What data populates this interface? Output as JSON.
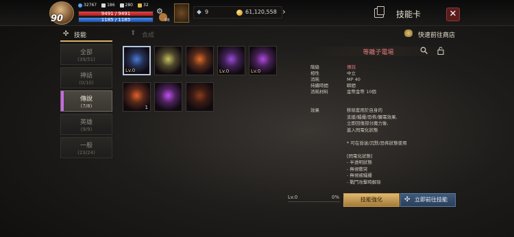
{
  "player": {
    "level": "90",
    "stats": [
      {
        "icon": "blue-gem-icon",
        "value": "32767",
        "color": "#5aa0ff"
      },
      {
        "icon": "sword-icon",
        "value": "186",
        "color": "#d8d8d8"
      },
      {
        "icon": "skull-icon",
        "value": "280",
        "color": "#d8d8d8"
      },
      {
        "icon": "trophy-icon",
        "value": "32",
        "color": "#e0b850"
      }
    ],
    "hp": "9491 / 9491",
    "mp": "1185 / 1185",
    "pouch_count": "98"
  },
  "resources": {
    "crystal": "9",
    "gold": "61,120,558"
  },
  "header": {
    "title": "技能卡",
    "close_glyph": "✕"
  },
  "tabs": {
    "skill": "技能",
    "compose": "合成",
    "shop_link": "快速前往商店"
  },
  "categories": [
    {
      "name": "全部",
      "count": "(39/51)",
      "active": false
    },
    {
      "name": "神話",
      "count": "(0/10)",
      "active": false
    },
    {
      "name": "傳說",
      "count": "(7/8)",
      "active": true
    },
    {
      "name": "英雄",
      "count": "(9/9)",
      "active": false
    },
    {
      "name": "一般",
      "count": "(23/24)",
      "active": false
    }
  ],
  "skills": [
    {
      "icon": "lightning-figure-skill-icon",
      "level": "Lv.0",
      "qty": "",
      "selected": true,
      "color": "#4a7ad8"
    },
    {
      "icon": "winged-blade-skill-icon",
      "level": "",
      "qty": "",
      "selected": false,
      "color": "#c8c060"
    },
    {
      "icon": "fire-ring-skill-icon",
      "level": "",
      "qty": "",
      "selected": false,
      "color": "#e06a2a"
    },
    {
      "icon": "purple-shield-skill-icon",
      "level": "Lv.0",
      "qty": "",
      "selected": false,
      "color": "#9a4ad8"
    },
    {
      "icon": "purple-orb-skill-icon",
      "level": "Lv.0",
      "qty": "",
      "selected": false,
      "color": "#b04ae0"
    },
    {
      "icon": "fire-burst-skill-icon",
      "level": "",
      "qty": "1",
      "selected": false,
      "color": "#e0602a"
    },
    {
      "icon": "purple-slash-skill-icon",
      "level": "",
      "qty": "",
      "selected": false,
      "color": "#c050f0"
    },
    {
      "icon": "dim-fire-skill-icon",
      "level": "",
      "qty": "",
      "selected": false,
      "color": "#8a3a1a"
    }
  ],
  "detail": {
    "name": "等離子電場",
    "attributes": [
      {
        "key": "階級",
        "value": "傳說",
        "highlight": true
      },
      {
        "key": "相性",
        "value": "中立",
        "highlight": false
      },
      {
        "key": "消耗",
        "value": "MP 40",
        "highlight": false
      },
      {
        "key": "持續時間",
        "value": "瞬間",
        "highlight": false
      },
      {
        "key": "消耗材料",
        "value": "金幣金幣 10個",
        "highlight": false
      }
    ],
    "effect_label": "效果",
    "effect_lines": [
      "移除套用於自身的",
      "支援/騷擾/恐佈/觸電效果,",
      "立即回復部分魔力後,",
      "進入閃電化狀態",
      "",
      "* 可在昏迷/沉默/恐佈狀態使用",
      "",
      "[閃電化狀態]",
      "- 半透明狀態",
      "- 無視衝突",
      "- 無視被騷擾",
      "- 戰鬥攻擊時解除"
    ],
    "progress_level": "Lv.0",
    "progress_pct": "0%",
    "enhance_button": "技能強化",
    "go_button": "立即前往技能"
  }
}
